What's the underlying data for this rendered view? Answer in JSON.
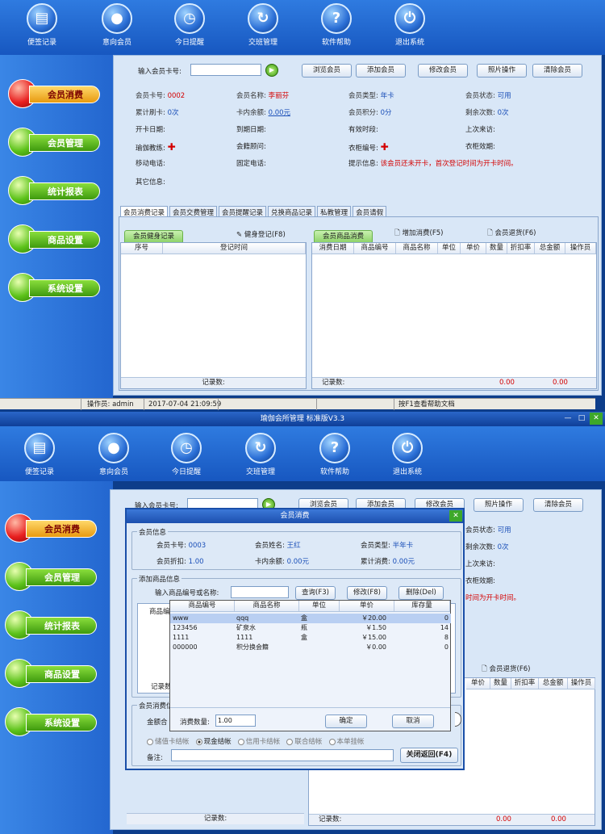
{
  "toolbar": [
    "便签记录",
    "意向会员",
    "今日提醒",
    "交班管理",
    "软件帮助",
    "退出系统"
  ],
  "toolbar_icons": [
    "notepad-icon",
    "member-icon",
    "clock-icon",
    "refresh-icon",
    "help-icon",
    "power-icon"
  ],
  "sidebar": [
    "会员消费",
    "会员管理",
    "统计报表",
    "商品设置",
    "系统设置"
  ],
  "search": {
    "label": "输入会员卡号:",
    "buttons": [
      "浏览会员",
      "添加会员",
      "修改会员",
      "照片操作",
      "清除会员"
    ]
  },
  "info": {
    "card_label": "会员卡号:",
    "card_val": "0002",
    "name_label": "会员名称:",
    "name_val": "李丽芬",
    "type_label": "会员类型:",
    "type_val": "年卡",
    "status_label": "会员状态:",
    "status_val": "可用",
    "swipe_label": "累计刷卡:",
    "swipe_val": "0次",
    "balance_label": "卡内余额:",
    "balance_val": "0.00元",
    "points_label": "会员积分:",
    "points_val": "0分",
    "remain_label": "剩余次数:",
    "remain_val": "0次",
    "open_label": "开卡日期:",
    "expire_label": "到期日期:",
    "period_label": "有效时段:",
    "last_label": "上次来访:",
    "coach_label": "瑜伽教练:",
    "advisor_label": "会籍顾问:",
    "locker_label": "衣柜编号:",
    "locker_exp_label": "衣柜效期:",
    "mobile_label": "移动电话:",
    "phone_label": "固定电话:",
    "tip_label": "提示信息:",
    "tip_val": "该会员还未开卡，首次登记时间为开卡时间。",
    "other_label": "其它信息:"
  },
  "tabs": [
    "会员消费记录",
    "会员交费管理",
    "会员提醒记录",
    "兑换商品记录",
    "私教管理",
    "会员请假"
  ],
  "left_panel": {
    "tab": "会员健身记录",
    "action": "健身登记(F8)",
    "headers": [
      "序号",
      "登记时间"
    ],
    "footer": "记录数:"
  },
  "right_panel": {
    "tab": "会员商品消费",
    "add": "增加消费(F5)",
    "ret": "会员退货(F6)",
    "headers": [
      "消费日期",
      "商品编号",
      "商品名称",
      "单位",
      "单价",
      "数量",
      "折扣率",
      "总金额",
      "操作员"
    ],
    "footer": "记录数:",
    "sum1": "0.00",
    "sum2": "0.00"
  },
  "status": {
    "operator": "操作员: admin",
    "time": "2017-07-04 21:09:59",
    "help": "按F1查看帮助文档"
  },
  "window_title": "瑜伽会所管理 标准版V3.3",
  "dialog": {
    "title": "会员消费",
    "info_group": "会员信息",
    "card_label": "会员卡号:",
    "card_val": "0003",
    "name_label": "会员姓名:",
    "name_val": "王红",
    "type_label": "会员类型:",
    "type_val": "半年卡",
    "disc_label": "会员折扣:",
    "disc_val": "1.00",
    "bal_label": "卡内余额:",
    "bal_val": "0.00元",
    "total_label": "累计消费:",
    "total_val": "0.00元",
    "add_group": "添加商品信息",
    "input_label": "输入商品编号或名称:",
    "btn_query": "查询(F3)",
    "btn_edit": "修改(F8)",
    "btn_del": "删除(Del)",
    "list_header": "商品编",
    "rec": "记录数",
    "consume_group": "会员消费信息",
    "amount_label": "金额合",
    "payments": [
      "储值卡结帐",
      "现金结帐",
      "信用卡结帐",
      "联合结帐",
      "本单挂帐"
    ],
    "remark_label": "备注:",
    "close_btn": "关闭返回(F4)"
  },
  "popup": {
    "headers": [
      "商品编号",
      "商品名称",
      "单位",
      "单价",
      "库存量"
    ],
    "rows": [
      [
        "www",
        "qqq",
        "盒",
        "￥20.00",
        "0"
      ],
      [
        "123456",
        "矿泉水",
        "瓶",
        "￥1.50",
        "14"
      ],
      [
        "1111",
        "1111",
        "盒",
        "￥15.00",
        "8"
      ],
      [
        "000000",
        "积分换会籍",
        "",
        "￥0.00",
        "0"
      ]
    ],
    "qty_label": "消费数量:",
    "qty_val": "1.00",
    "ok": "确定",
    "cancel": "取消"
  },
  "bg2": {
    "status_val": "可用",
    "remain_val": "0次",
    "tip_partial": "时间为开卡时间。",
    "ret": "会员退货(F6)",
    "headers": [
      "单价",
      "数量",
      "折扣率",
      "总金额",
      "操作员"
    ],
    "footer": "记录数:",
    "sum1": "0.00",
    "sum2": "0.00"
  }
}
